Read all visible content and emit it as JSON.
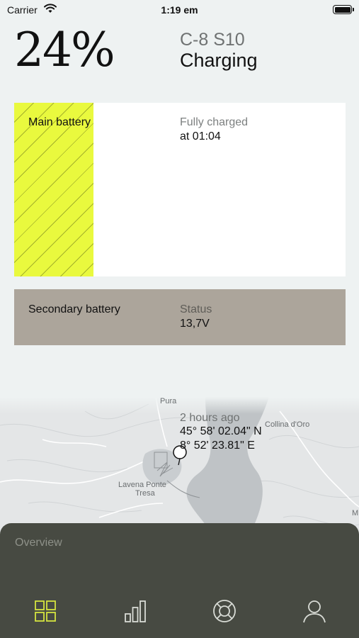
{
  "status_bar": {
    "carrier": "Carrier",
    "time": "1:19 em",
    "icons": [
      "wifi-icon",
      "battery-icon"
    ]
  },
  "header": {
    "percent": "24%",
    "device_name": "C-8 S10",
    "charge_state": "Charging"
  },
  "main_battery": {
    "label": "Main battery",
    "status_title": "Fully charged",
    "status_value": "at 01:04",
    "fill_fraction": 0.24,
    "fill_color": "#e9f93e"
  },
  "secondary_battery": {
    "label": "Secondary battery",
    "status_title": "Status",
    "status_value": "13,7V",
    "card_color": "#aca59b"
  },
  "map": {
    "time_ago": "2 hours ago",
    "latitude": "45° 58' 02.04\" N",
    "longitude": "8° 52' 23.81\" E",
    "place_labels": [
      "Pura",
      "Collina d'Oro",
      "Lavena Ponte",
      "Tresa",
      "M"
    ],
    "marker": "location-pin-icon"
  },
  "bottom_sheet": {
    "title": "Overview",
    "background": "#474a42",
    "active_color": "#d4e33f",
    "tabs": [
      {
        "icon": "grid-icon",
        "active": true
      },
      {
        "icon": "bar-chart-icon",
        "active": false
      },
      {
        "icon": "lifebuoy-icon",
        "active": false
      },
      {
        "icon": "user-icon",
        "active": false
      }
    ]
  }
}
